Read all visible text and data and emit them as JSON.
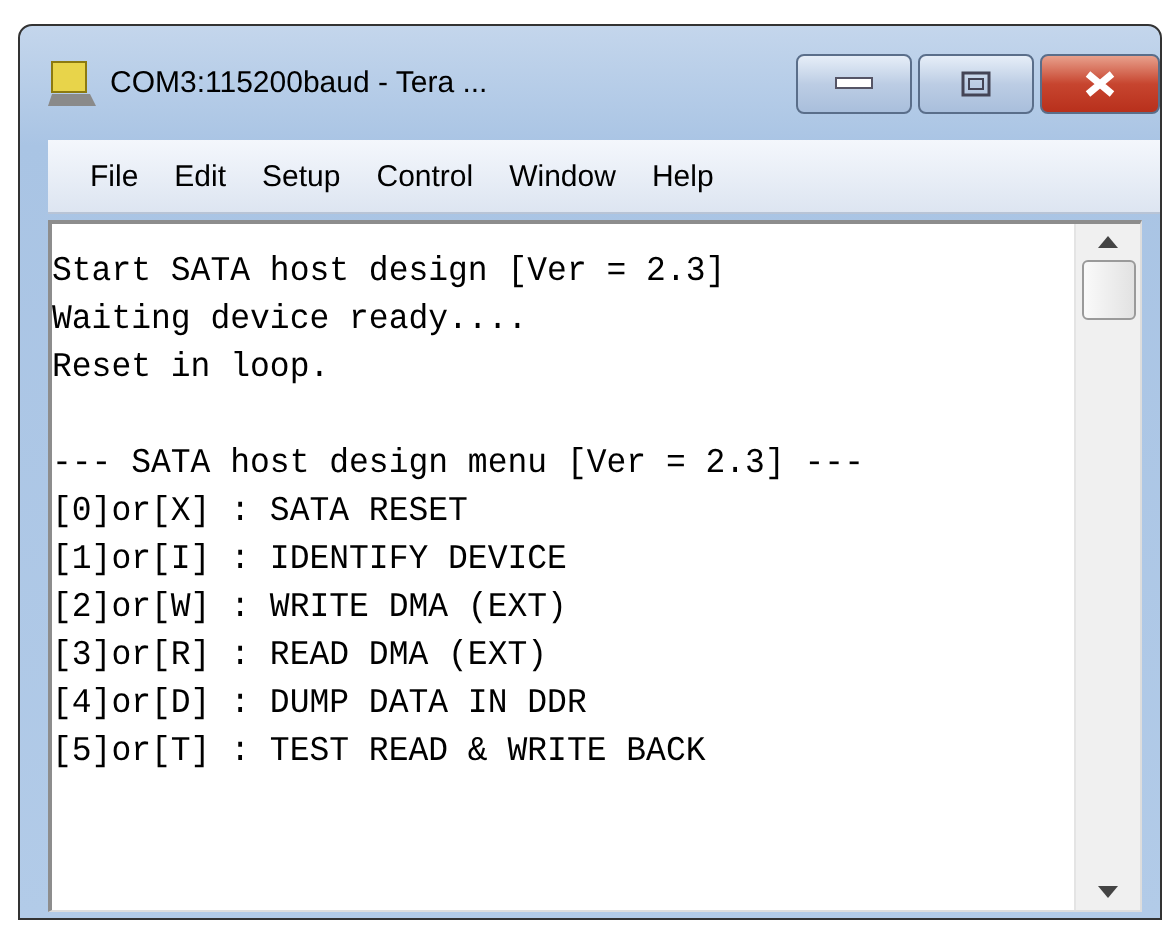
{
  "window": {
    "title": "COM3:115200baud - Tera ..."
  },
  "menu": [
    "File",
    "Edit",
    "Setup",
    "Control",
    "Window",
    "Help"
  ],
  "terminal": {
    "blocks": [
      [
        "Start SATA host design [Ver = 2.3]",
        "Waiting device ready....",
        "Reset in loop."
      ],
      [
        "--- SATA host design menu [Ver = 2.3] ---",
        "[0]or[X] : SATA RESET",
        "[1]or[I] : IDENTIFY DEVICE",
        "[2]or[W] : WRITE DMA (EXT)",
        "[3]or[R] : READ DMA (EXT)",
        "[4]or[D] : DUMP DATA IN DDR",
        "[5]or[T] : TEST READ & WRITE BACK"
      ]
    ]
  }
}
